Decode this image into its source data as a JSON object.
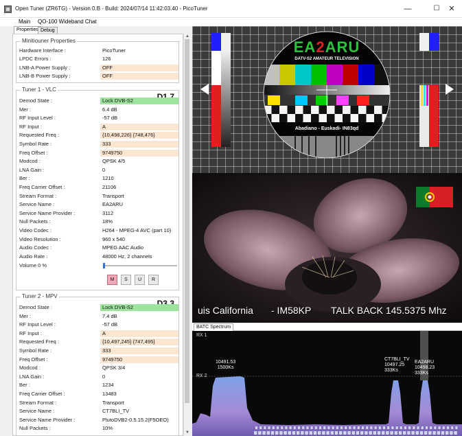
{
  "window": {
    "title": "Open Tuner (ZR6TG) - Version 0.B - Build: 2024/07/14 11:42:03.40 - PicoTuner",
    "minimize": "—",
    "maximize": "☐",
    "close": "✕"
  },
  "menu": [
    "Main",
    "QO-100 Wideband Chat"
  ],
  "tabs": [
    "Properties",
    "Debug"
  ],
  "minitiouner": {
    "title": "Minitiouner Properties",
    "rows": [
      {
        "label": "Hardware Interface :",
        "value": "PicoTuner"
      },
      {
        "label": "LPDC Errors :",
        "value": "126"
      },
      {
        "label": "LNB-A Power Supply :",
        "value": "OFF"
      },
      {
        "label": "LNB-B Power Supply :",
        "value": "OFF"
      }
    ]
  },
  "tuner1": {
    "title": "Tuner 1 - VLC",
    "id": "D1.7",
    "rows": [
      {
        "label": "Demod State :",
        "value": "Lock DVB-S2"
      },
      {
        "label": "Mer :",
        "value": "6.4 dB"
      },
      {
        "label": "RF Input Level :",
        "value": "-57 dB"
      },
      {
        "label": "RF Input :",
        "value": "A"
      },
      {
        "label": "Requested Freq :",
        "value": "{10,498,226} {748,476}"
      },
      {
        "label": "Symbol Rate :",
        "value": "333"
      },
      {
        "label": "Freq Offset :",
        "value": "9749750"
      },
      {
        "label": "Modcod :",
        "value": "QPSK 4/5"
      },
      {
        "label": "LNA Gain :",
        "value": "0"
      },
      {
        "label": "Ber :",
        "value": "1210"
      },
      {
        "label": "Freq Carrier Offset :",
        "value": "21106"
      },
      {
        "label": "Stream Format :",
        "value": "Transport"
      },
      {
        "label": "Service Name :",
        "value": "EA2ARU"
      },
      {
        "label": "Service Name Provider :",
        "value": "3112"
      },
      {
        "label": "Null Packets :",
        "value": "18%"
      },
      {
        "label": "Video Codec :",
        "value": "H264 - MPEG-4 AVC (part 10)"
      },
      {
        "label": "Video Resolution :",
        "value": "960 x 540"
      },
      {
        "label": "Audio Codec :",
        "value": "MPEG AAC Audio"
      },
      {
        "label": "Audio Rate :",
        "value": "48000 Hz, 2 channels"
      }
    ],
    "volume_label": "Volume 0 %",
    "volume": 0,
    "buttons": [
      "M",
      "S",
      "U",
      "R"
    ]
  },
  "tuner2": {
    "title": "Tuner 2 - MPV",
    "id": "D3.3",
    "rows": [
      {
        "label": "Demod State :",
        "value": "Lock DVB-S2"
      },
      {
        "label": "Mer :",
        "value": "7.4 dB"
      },
      {
        "label": "RF Input Level :",
        "value": "-57 dB"
      },
      {
        "label": "RF Input :",
        "value": "A"
      },
      {
        "label": "Requested Freq :",
        "value": "{10,497,245} {747,495}"
      },
      {
        "label": "Symbol Rate :",
        "value": "333"
      },
      {
        "label": "Freq Offset :",
        "value": "9749750"
      },
      {
        "label": "Modcod :",
        "value": "QPSK 3/4"
      },
      {
        "label": "LNA Gain :",
        "value": "0"
      },
      {
        "label": "Ber :",
        "value": "1234"
      },
      {
        "label": "Freq Carrier Offset :",
        "value": "13483"
      },
      {
        "label": "Stream Format :",
        "value": "Transport"
      },
      {
        "label": "Service Name :",
        "value": "CT7BLI_TV"
      },
      {
        "label": "Service Name Provider :",
        "value": "PlutoDVB2-0.5.15.2(F5OEO)"
      },
      {
        "label": "Null Packets :",
        "value": "10%"
      }
    ]
  },
  "video1": {
    "logo": "EA2ARU",
    "subtitle": "DATV-S2 AMATEUR TELEVISION",
    "location": "Abadiano - Euskadi- IN83qd"
  },
  "video2": {
    "osd_name": "uis California",
    "osd_locator": "- IM58KP",
    "osd_talkback": "TALK BACK 145.5375 Mhz"
  },
  "spectrum": {
    "tab": "BATC Spectrum",
    "rx1": "RX 1",
    "rx2": "RX 2",
    "signals": [
      {
        "name": "",
        "freq": "10491.53",
        "rate": "1500Ks"
      },
      {
        "name": "CT7BLI_TV",
        "freq": "10497.25",
        "rate": "333Ks"
      },
      {
        "name": "EA2ARU",
        "freq": "10498.23",
        "rate": "333Ks"
      }
    ]
  },
  "colors": {
    "accent_green": "#9ee39e",
    "peach": "#fbe6d1",
    "logo_green": "#29c43a",
    "logo_red": "#e02222",
    "spectrum_fill": "#9c8ad6"
  }
}
